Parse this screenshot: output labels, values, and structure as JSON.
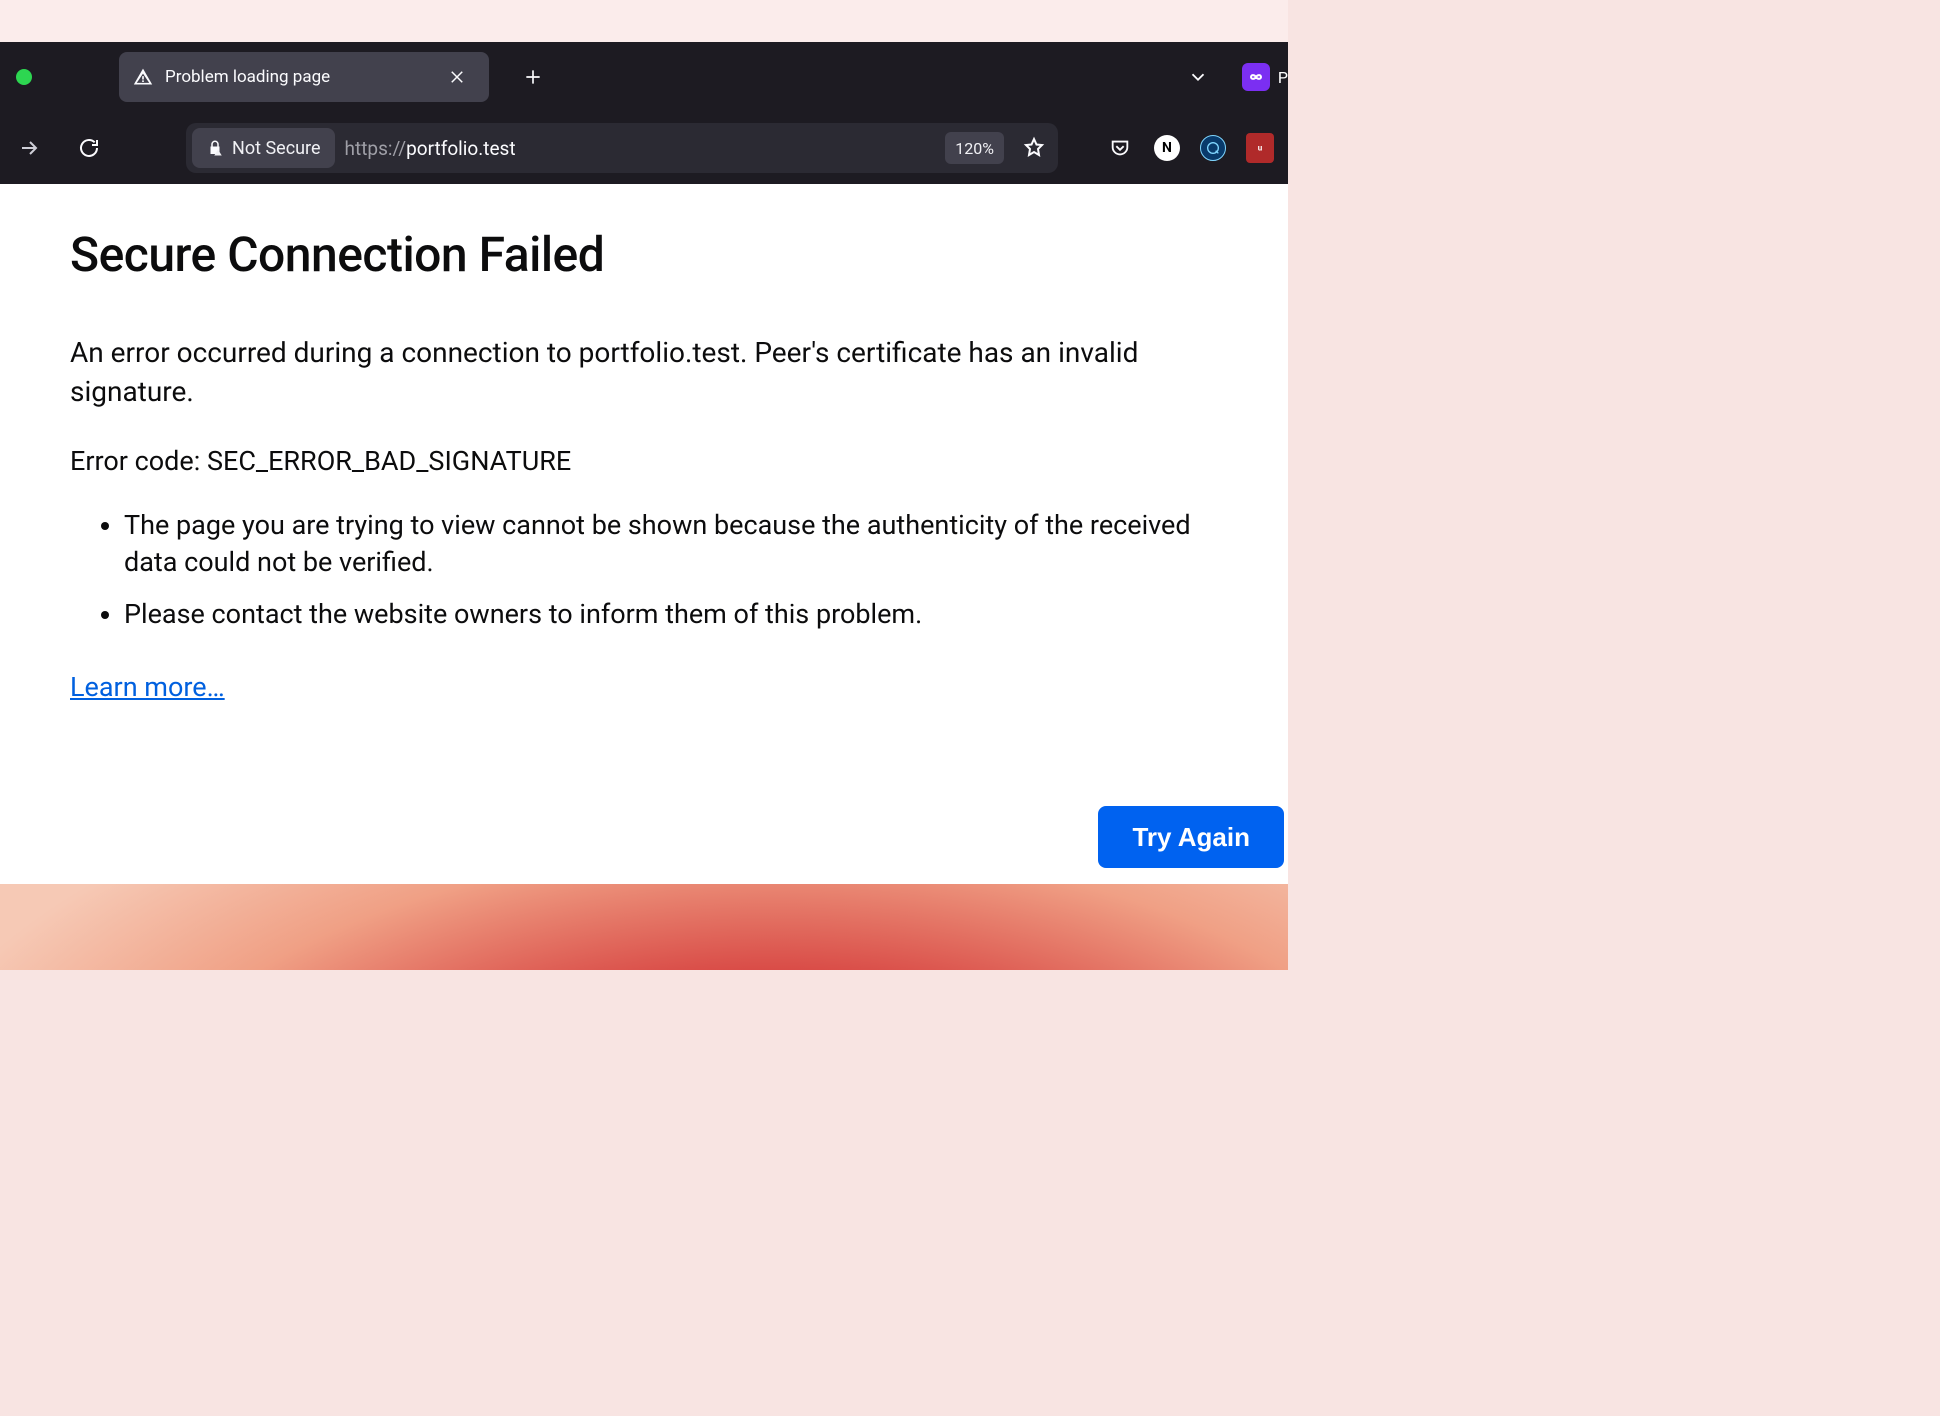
{
  "tab": {
    "title": "Problem loading page"
  },
  "profile_partial": "P",
  "toolbar": {
    "security_label": "Not Secure",
    "url_scheme": "https://",
    "url_host": "portfolio.test",
    "zoom": "120%"
  },
  "error": {
    "heading": "Secure Connection Failed",
    "message": "An error occurred during a connection to portfolio.test. Peer's certificate has an invalid signature.",
    "code": "Error code: SEC_ERROR_BAD_SIGNATURE",
    "bullets": [
      "The page you are trying to view cannot be shown because the authenticity of the received data could not be verified.",
      "Please contact the website owners to inform them of this problem."
    ],
    "learn_more": "Learn more…",
    "try_again": "Try Again"
  }
}
